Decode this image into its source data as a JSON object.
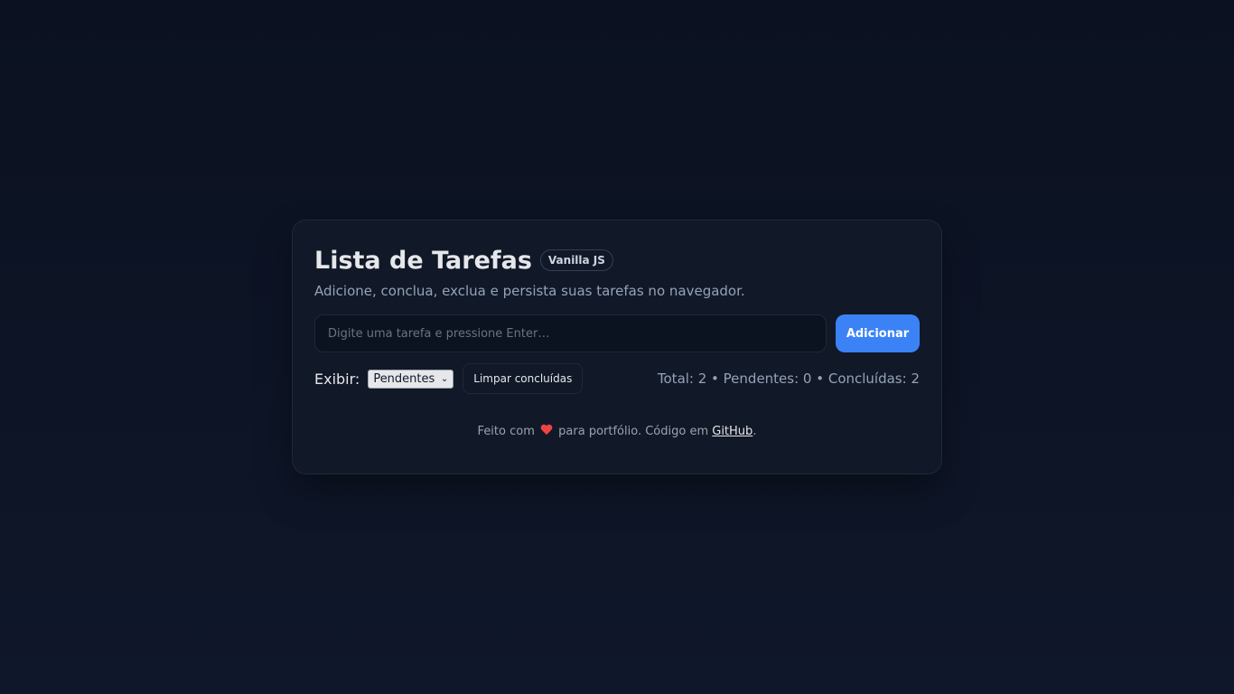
{
  "header": {
    "title": "Lista de Tarefas",
    "badge": "Vanilla JS",
    "subtitle": "Adicione, conclua, exclua e persista suas tarefas no navegador."
  },
  "input": {
    "placeholder": "Digite uma tarefa e pressione Enter…",
    "value": ""
  },
  "add_button_label": "Adicionar",
  "filter": {
    "label": "Exibir:",
    "selected": "Pendentes"
  },
  "clear_button_label": "Limpar concluídas",
  "stats": "Total: 2 • Pendentes: 0 • Concluídas: 2",
  "footer": {
    "prefix": "Feito com",
    "heart_icon": "heart-icon",
    "middle": "para portfólio. Código em",
    "link_text": "GitHub",
    "suffix": "."
  },
  "colors": {
    "accent": "#3b82f6",
    "background": "#0f172a",
    "card": "#111827",
    "heart": "#ef4444"
  }
}
